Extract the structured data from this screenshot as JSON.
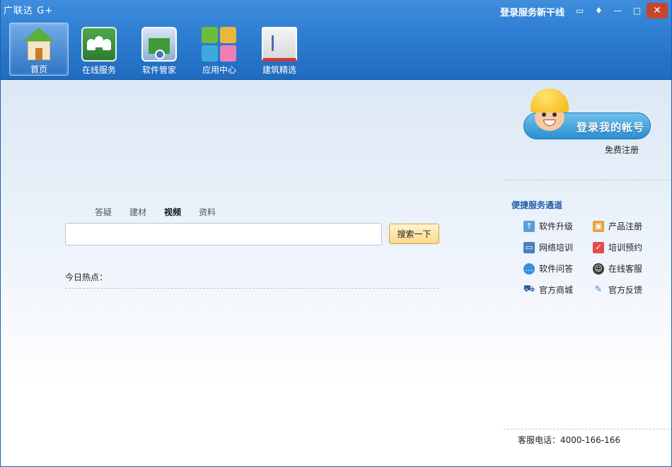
{
  "window": {
    "title": "广联达 G+",
    "login_line": "登录服务新干线",
    "buttons": [
      "chat",
      "skin",
      "minimize",
      "maximize",
      "close"
    ]
  },
  "nav": {
    "items": [
      {
        "label": "首页",
        "icon": "home-icon",
        "active": true
      },
      {
        "label": "在线服务",
        "icon": "online-service-icon",
        "active": false
      },
      {
        "label": "软件管家",
        "icon": "software-manager-icon",
        "active": false
      },
      {
        "label": "应用中心",
        "icon": "app-center-icon",
        "active": false
      },
      {
        "label": "建筑精选",
        "icon": "architecture-book-icon",
        "active": false
      }
    ]
  },
  "login_promo": {
    "button_label": "登录我的帐号",
    "register_link": "免费注册"
  },
  "services": {
    "title": "便捷服务通道",
    "items": [
      {
        "label": "软件升级",
        "icon": "upgrade-icon"
      },
      {
        "label": "产品注册",
        "icon": "product-register-icon"
      },
      {
        "label": "网络培训",
        "icon": "online-training-icon"
      },
      {
        "label": "培训预约",
        "icon": "training-booking-icon"
      },
      {
        "label": "软件问答",
        "icon": "qa-bubble-icon"
      },
      {
        "label": "在线客服",
        "icon": "customer-service-icon"
      },
      {
        "label": "官方商城",
        "icon": "shopping-cart-icon"
      },
      {
        "label": "官方反馈",
        "icon": "feedback-icon"
      }
    ]
  },
  "search": {
    "tabs": [
      "答疑",
      "建材",
      "视频",
      "资料"
    ],
    "active_tab": "视频",
    "input_value": "",
    "button_label": "搜索一下"
  },
  "hot": {
    "label": "今日热点："
  },
  "footer": {
    "phone": "客服电话：4000-166-166"
  },
  "colors": {
    "header": "#2f7fd3",
    "service_title": "#1f5fa8"
  }
}
